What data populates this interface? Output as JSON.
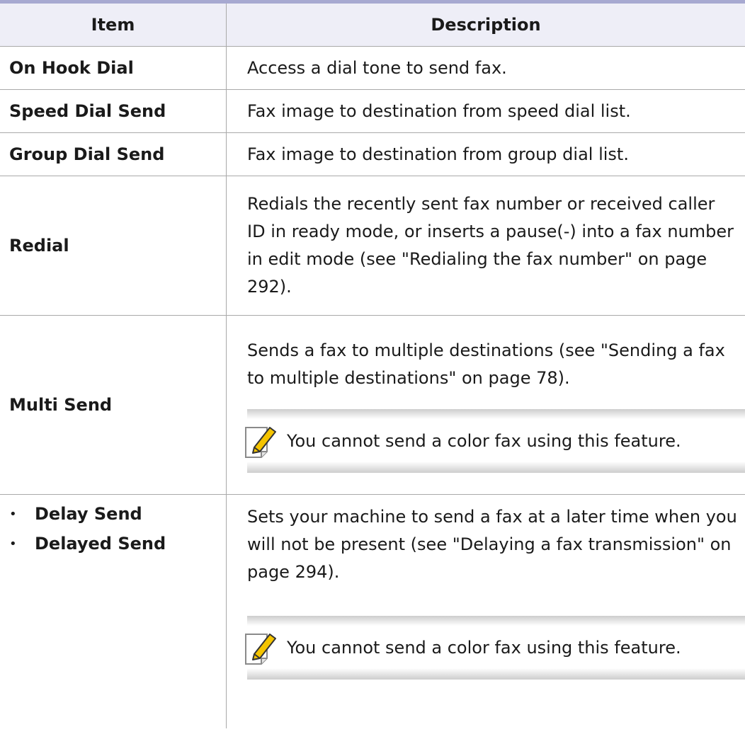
{
  "header": {
    "item": "Item",
    "description": "Description"
  },
  "rows": [
    {
      "item": "On Hook Dial",
      "description": "Access a dial tone to send fax."
    },
    {
      "item": "Speed Dial Send",
      "description": "Fax image to destination from speed dial list."
    },
    {
      "item": "Group Dial Send",
      "description": "Fax image to destination from group dial list."
    },
    {
      "item": "Redial",
      "description": "Redials the recently sent fax number or received caller ID in ready mode, or inserts a pause(-) into a fax number in edit mode (see \"Redialing the fax number\" on page 292)."
    },
    {
      "item": "Multi Send",
      "description": "Sends a fax to multiple destinations (see \"Sending a fax to multiple destinations\" on page 78).",
      "note": "You cannot send a color fax using this feature."
    },
    {
      "items": [
        "Delay Send",
        "Delayed Send"
      ],
      "description": "Sets your machine to send a fax at a later time when you will not be present (see \"Delaying a fax transmission\" on page 294).",
      "note": "You cannot send a color fax using this feature."
    }
  ],
  "icons": {
    "note": "note-pencil-icon"
  },
  "colors": {
    "top_rule": "#a7a9d1",
    "header_bg": "#eeeef7",
    "pencil": "#f5c400"
  }
}
